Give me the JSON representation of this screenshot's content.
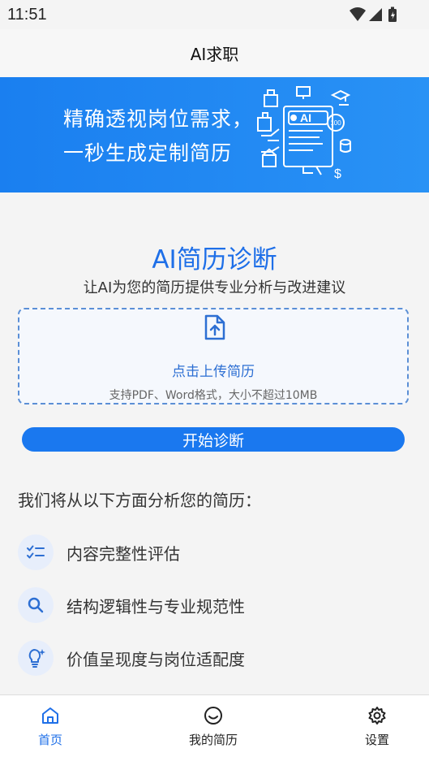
{
  "status_bar": {
    "time": "11:51"
  },
  "header": {
    "title": "AI求职"
  },
  "banner": {
    "line1": "精确透视岗位需求，",
    "line2": "一秒生成定制简历",
    "badge_text": "AI",
    "score_text": "100"
  },
  "diagnosis": {
    "title": "AI简历诊断",
    "subtitle": "让AI为您的简历提供专业分析与改进建议"
  },
  "upload": {
    "label": "点击上传简历",
    "hint": "支持PDF、Word格式，大小不超过10MB"
  },
  "start_button": {
    "label": "开始诊断"
  },
  "aspects": {
    "heading": "我们将从以下方面分析您的简历：",
    "items": [
      {
        "label": "内容完整性评估",
        "icon": "checklist-icon"
      },
      {
        "label": "结构逻辑性与专业规范性",
        "icon": "search-icon"
      },
      {
        "label": "价值呈现度与岗位适配度",
        "icon": "lightbulb-icon"
      }
    ]
  },
  "bottom_nav": {
    "items": [
      {
        "label": "首页",
        "icon": "home-icon",
        "active": true
      },
      {
        "label": "我的简历",
        "icon": "smile-icon",
        "active": false
      },
      {
        "label": "设置",
        "icon": "gear-icon",
        "active": false
      }
    ]
  },
  "colors": {
    "primary": "#1a78ef",
    "title_blue": "#1e6fe8",
    "banner_start": "#1a7ff0",
    "banner_end": "#2992f5"
  }
}
